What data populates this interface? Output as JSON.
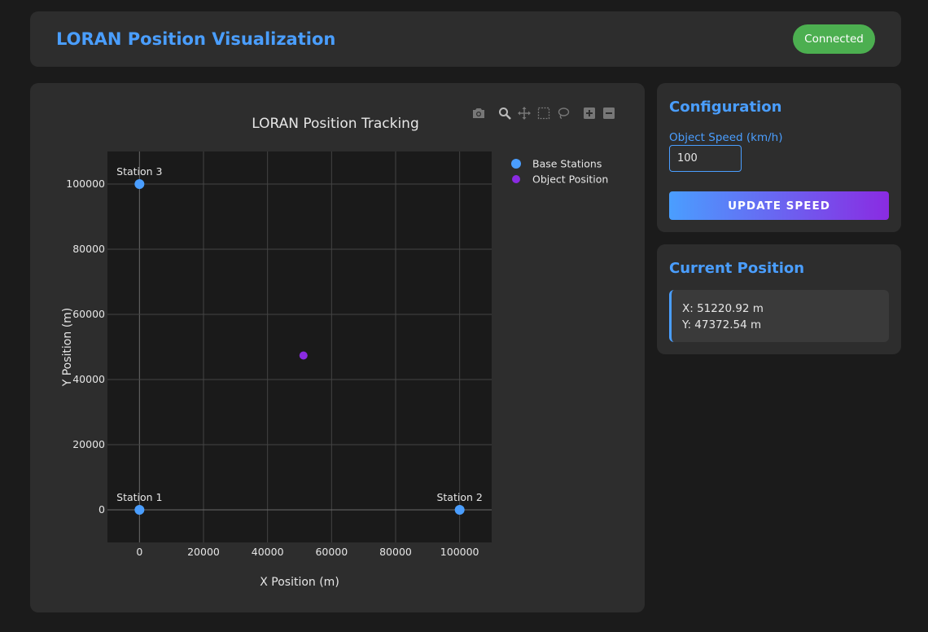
{
  "header": {
    "title": "LORAN Position Visualization",
    "status": "Connected",
    "status_color": "#4caf50",
    "accent_color": "#4a9eff"
  },
  "modebar": {
    "icons": [
      "camera-icon",
      "zoom-icon",
      "pan-icon",
      "box-select-icon",
      "lasso-select-icon",
      "zoom-in-icon",
      "zoom-out-icon"
    ]
  },
  "chart_data": {
    "type": "scatter",
    "title": "LORAN Position Tracking",
    "xlabel": "X Position (m)",
    "ylabel": "Y Position (m)",
    "xlim": [
      -10000,
      110000
    ],
    "ylim": [
      -10000,
      110000
    ],
    "xticks": [
      0,
      20000,
      40000,
      60000,
      80000,
      100000
    ],
    "yticks": [
      0,
      20000,
      40000,
      60000,
      80000,
      100000
    ],
    "grid": true,
    "legend_position": "right",
    "series": [
      {
        "name": "Base Stations",
        "color": "#4a9eff",
        "points": [
          {
            "x": 0,
            "y": 0,
            "label": "Station 1"
          },
          {
            "x": 100000,
            "y": 0,
            "label": "Station 2"
          },
          {
            "x": 0,
            "y": 100000,
            "label": "Station 3"
          }
        ]
      },
      {
        "name": "Object Position",
        "color": "#8a2be2",
        "points": [
          {
            "x": 51220.92,
            "y": 47372.54
          }
        ]
      }
    ]
  },
  "config": {
    "title": "Configuration",
    "speed_label": "Object Speed (km/h)",
    "speed_value": "100",
    "button_label": "UPDATE SPEED"
  },
  "position": {
    "title": "Current Position",
    "x_text": "X: 51220.92 m",
    "y_text": "Y: 47372.54 m"
  }
}
